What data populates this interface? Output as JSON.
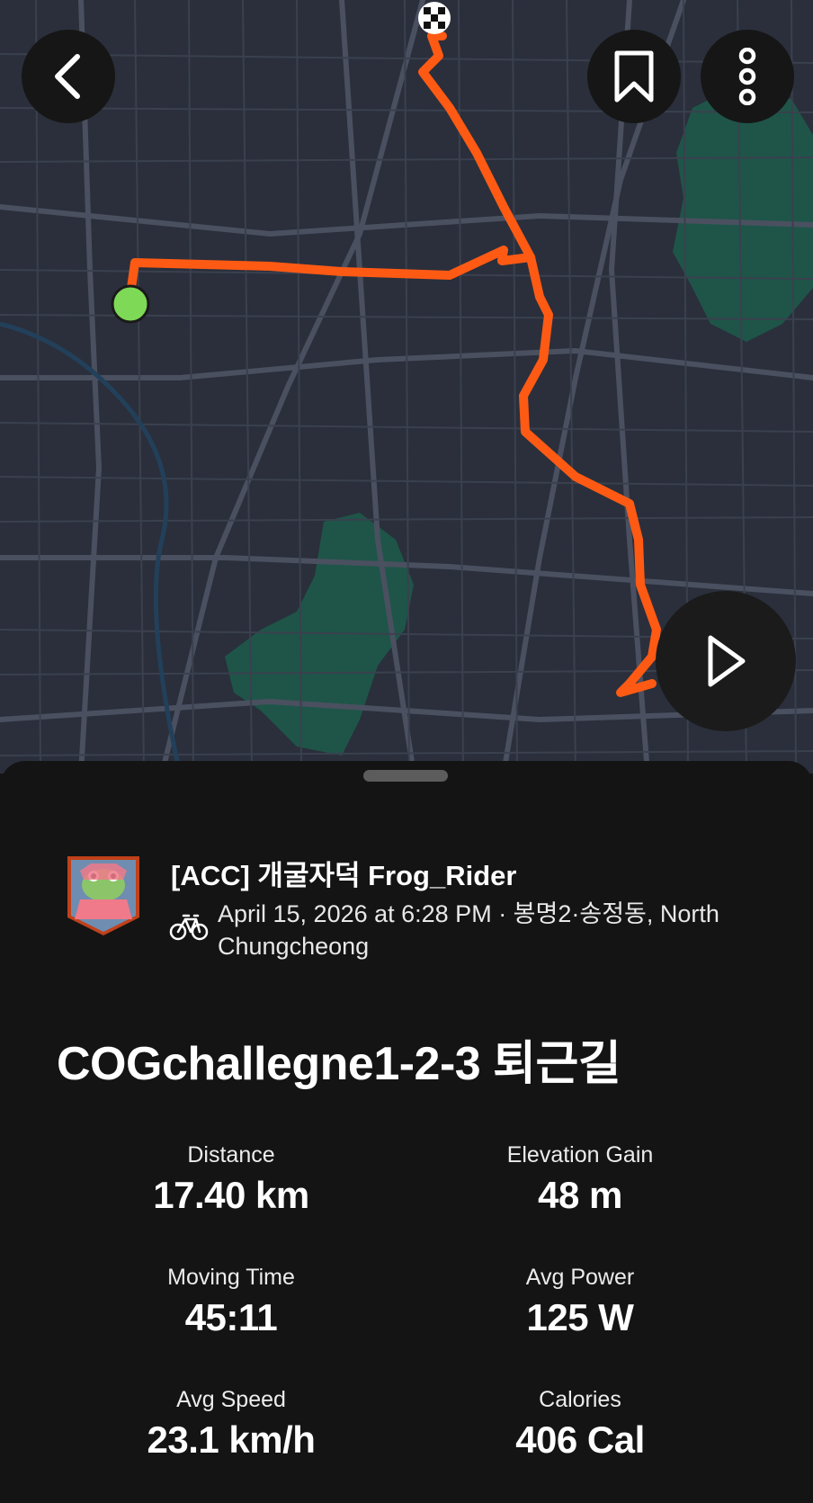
{
  "map": {
    "route_color": "#ff5a14",
    "start_marker_color": "#7ed957",
    "background_color": "#2a2f3b",
    "park_color": "#1d5a4a"
  },
  "controls": {
    "back_icon": "chevron-left-icon",
    "bookmark_icon": "bookmark-icon",
    "more_icon": "more-vertical-icon",
    "play_icon": "play-icon"
  },
  "athlete": {
    "name": "[ACC] 개굴자덕 Frog_Rider",
    "activity_type_icon": "bike-icon"
  },
  "activity": {
    "meta": "April 15, 2026 at 6:28 PM · 봉명2·송정동, North Chungcheong",
    "title": "COGchallegne1-2-3 퇴근길"
  },
  "stats": [
    {
      "label": "Distance",
      "value": "17.40 km"
    },
    {
      "label": "Elevation Gain",
      "value": "48 m"
    },
    {
      "label": "Moving Time",
      "value": "45:11"
    },
    {
      "label": "Avg Power",
      "value": "125 W"
    },
    {
      "label": "Avg Speed",
      "value": "23.1 km/h"
    },
    {
      "label": "Calories",
      "value": "406 Cal"
    }
  ]
}
